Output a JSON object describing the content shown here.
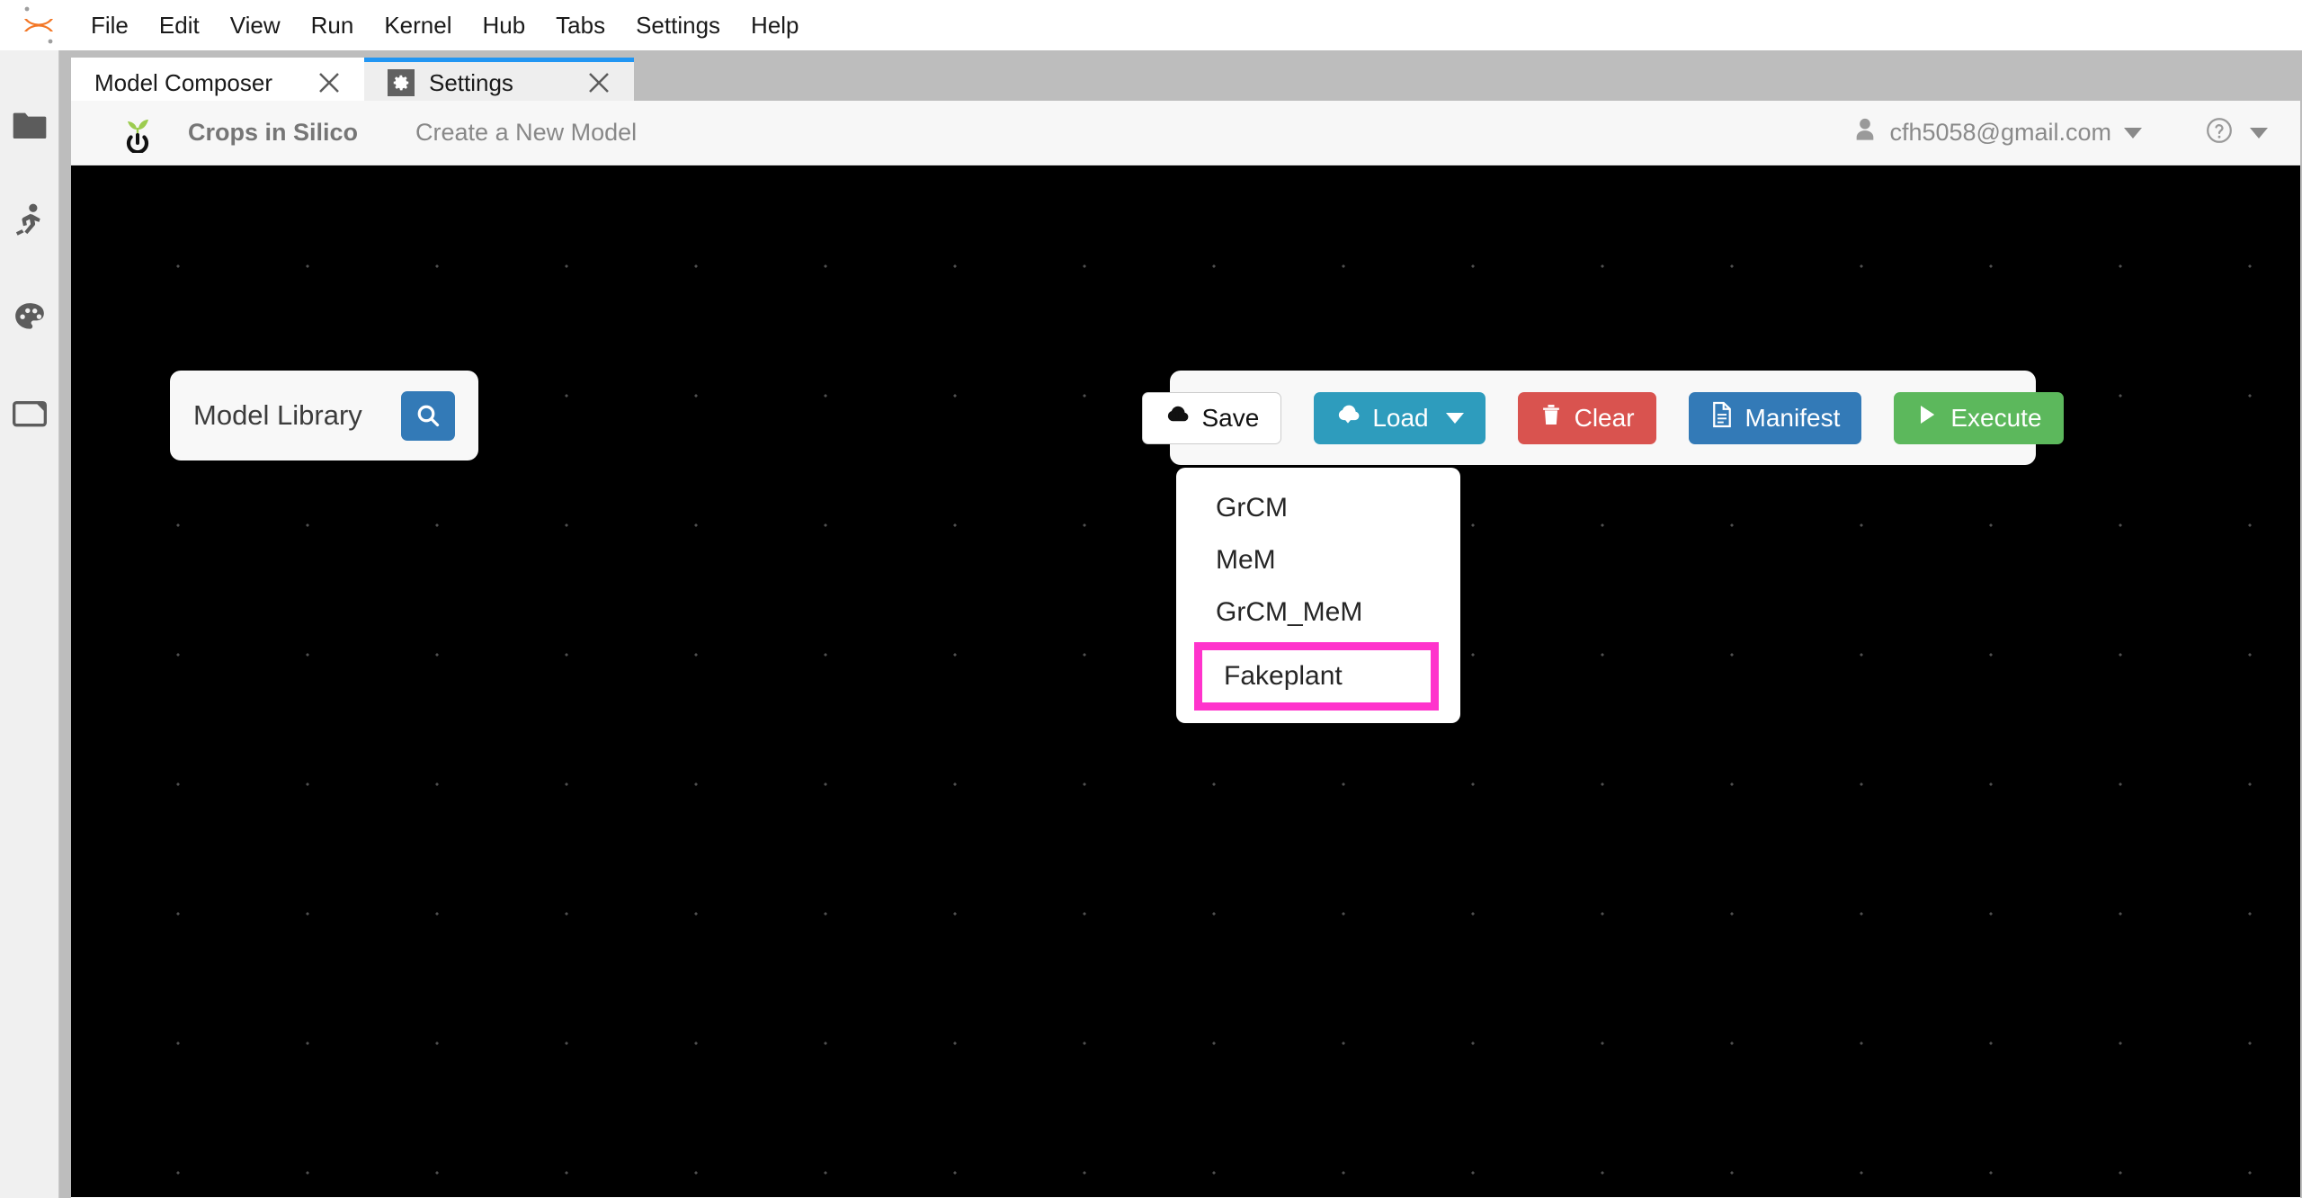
{
  "menubar": {
    "logo_icon": "jupyter-logo",
    "items": [
      "File",
      "Edit",
      "View",
      "Run",
      "Kernel",
      "Hub",
      "Tabs",
      "Settings",
      "Help"
    ]
  },
  "sidebar": {
    "items": [
      {
        "icon": "folder-icon",
        "label": "File Browser"
      },
      {
        "icon": "running-person-icon",
        "label": "Running Terminals and Kernels"
      },
      {
        "icon": "palette-icon",
        "label": "Commands"
      },
      {
        "icon": "extension-folder-icon",
        "label": "Extension Manager"
      }
    ]
  },
  "tabs": [
    {
      "label": "Model Composer",
      "icon": null,
      "close_icon": "close-icon",
      "state": "active"
    },
    {
      "label": "Settings",
      "icon": "gear-icon",
      "close_icon": "close-icon",
      "state": "current"
    }
  ],
  "app_header": {
    "logo_icon": "crops-sprout-logo",
    "brand": "Crops in Silico",
    "nav_link": "Create a New Model",
    "user": {
      "icon": "person-icon",
      "email": "cfh5058@gmail.com",
      "caret_icon": "chevron-down-icon"
    },
    "help": {
      "icon": "help-circle-icon",
      "caret_icon": "chevron-down-icon"
    }
  },
  "model_library": {
    "title": "Model Library",
    "search_icon": "search-icon"
  },
  "toolbar": {
    "buttons": [
      {
        "label": "Save",
        "icon": "cloud-upload-icon",
        "color": "#ffffff",
        "has_caret": false
      },
      {
        "label": "Load",
        "icon": "cloud-download-icon",
        "color": "#2e9cbd",
        "has_caret": true
      },
      {
        "label": "Clear",
        "icon": "trash-icon",
        "color": "#d9534f",
        "has_caret": false
      },
      {
        "label": "Manifest",
        "icon": "document-icon",
        "color": "#337ab7",
        "has_caret": false
      },
      {
        "label": "Execute",
        "icon": "play-icon",
        "color": "#5cb85c",
        "has_caret": false
      }
    ]
  },
  "load_dropdown": {
    "open": true,
    "highlight_color": "#ff33cc",
    "items": [
      {
        "label": "GrCM",
        "highlighted": false
      },
      {
        "label": "MeM",
        "highlighted": false
      },
      {
        "label": "GrCM_MeM",
        "highlighted": false
      },
      {
        "label": "Fakeplant",
        "highlighted": true
      }
    ]
  },
  "canvas": {
    "background_color": "#000000",
    "dot_color": "#505050"
  }
}
